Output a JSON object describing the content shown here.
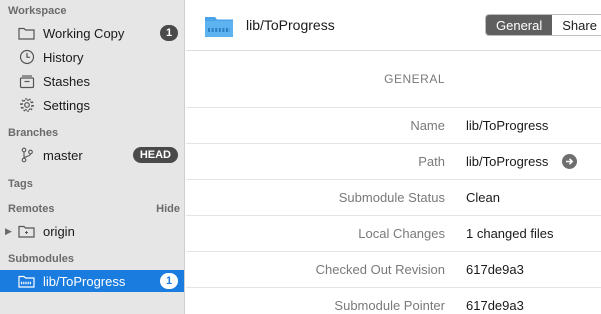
{
  "sidebar": {
    "workspace_header": "Workspace",
    "workspace_items": [
      {
        "label": "Working Copy",
        "icon": "folder-icon",
        "badge": "1"
      },
      {
        "label": "History",
        "icon": "clock-icon"
      },
      {
        "label": "Stashes",
        "icon": "stash-icon"
      },
      {
        "label": "Settings",
        "icon": "gear-icon"
      }
    ],
    "branches_header": "Branches",
    "branches": [
      {
        "label": "master",
        "icon": "branch-icon",
        "badge": "HEAD"
      }
    ],
    "tags_header": "Tags",
    "remotes_header": "Remotes",
    "remotes_hide": "Hide",
    "remotes": [
      {
        "label": "origin",
        "icon": "folder-icon"
      }
    ],
    "submodules_header": "Submodules",
    "submodules": [
      {
        "label": "lib/ToProgress",
        "icon": "submodule-icon",
        "badge": "1",
        "selected": true
      }
    ]
  },
  "header": {
    "title": "lib/ToProgress",
    "tabs": [
      "General",
      "Share"
    ],
    "active_tab": "General"
  },
  "details": {
    "group_title": "GENERAL",
    "rows": [
      {
        "key": "Name",
        "value": "lib/ToProgress"
      },
      {
        "key": "Path",
        "value": "lib/ToProgress"
      },
      {
        "key": "Submodule Status",
        "value": "Clean"
      },
      {
        "key": "Local Changes",
        "value": "1 changed files"
      },
      {
        "key": "Checked Out Revision",
        "value": "617de9a3"
      },
      {
        "key": "Submodule Pointer",
        "value": "617de9a3"
      }
    ]
  },
  "colors": {
    "sidebar_bg": "#e6e6e6",
    "selection": "#1b7ce0",
    "badge": "#4a4a4a",
    "folder_blue": "#4aa3e8"
  }
}
